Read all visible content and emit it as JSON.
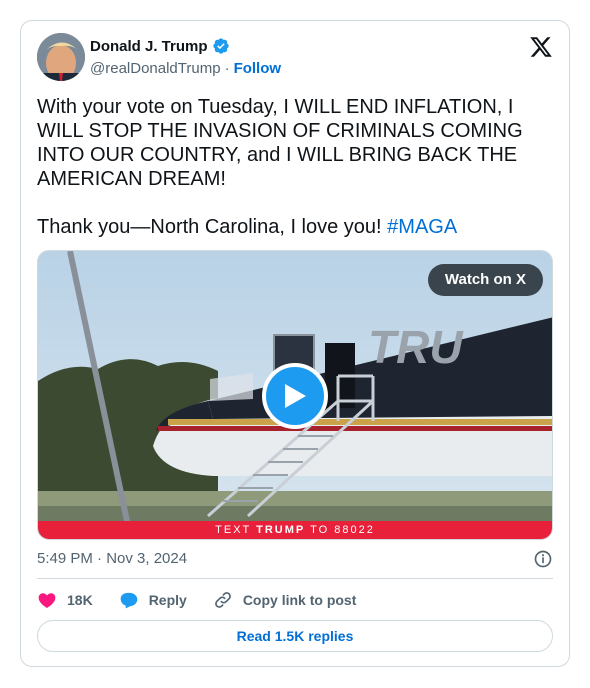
{
  "author": {
    "name": "Donald J. Trump",
    "handle": "@realDonaldTrump",
    "separator": "·",
    "follow_label": "Follow"
  },
  "tweet": {
    "paragraph1": "With your vote on Tuesday, I WILL END INFLATION, I WILL STOP THE INVASION OF CRIMINALS COMING INTO OUR COUNTRY, and I WILL BRING BACK THE AMERICAN DREAM!",
    "paragraph2_text": "Thank you—North Carolina, I love you! ",
    "hashtag": "#MAGA"
  },
  "media": {
    "watch_label": "Watch on X",
    "banner_prefix": "TEXT ",
    "banner_bold": "TRUMP",
    "banner_suffix": " TO 88022",
    "plane_text": "TRU"
  },
  "timestamp": "5:49 PM · Nov 3, 2024",
  "actions": {
    "likes_count": "18K",
    "reply_label": "Reply",
    "copy_label": "Copy link to post"
  },
  "replies_button": "Read 1.5K replies",
  "colors": {
    "brand_blue": "#1d9bf0",
    "link_blue": "#006fd6",
    "heart_pink": "#f91880",
    "banner_red": "#e8203a",
    "text_secondary": "#536471"
  },
  "icons": {
    "verified": "verified-badge-icon",
    "x_logo": "x-logo-icon",
    "play": "play-icon",
    "info": "info-icon",
    "heart": "heart-icon",
    "reply": "reply-bubble-icon",
    "link": "link-icon"
  }
}
